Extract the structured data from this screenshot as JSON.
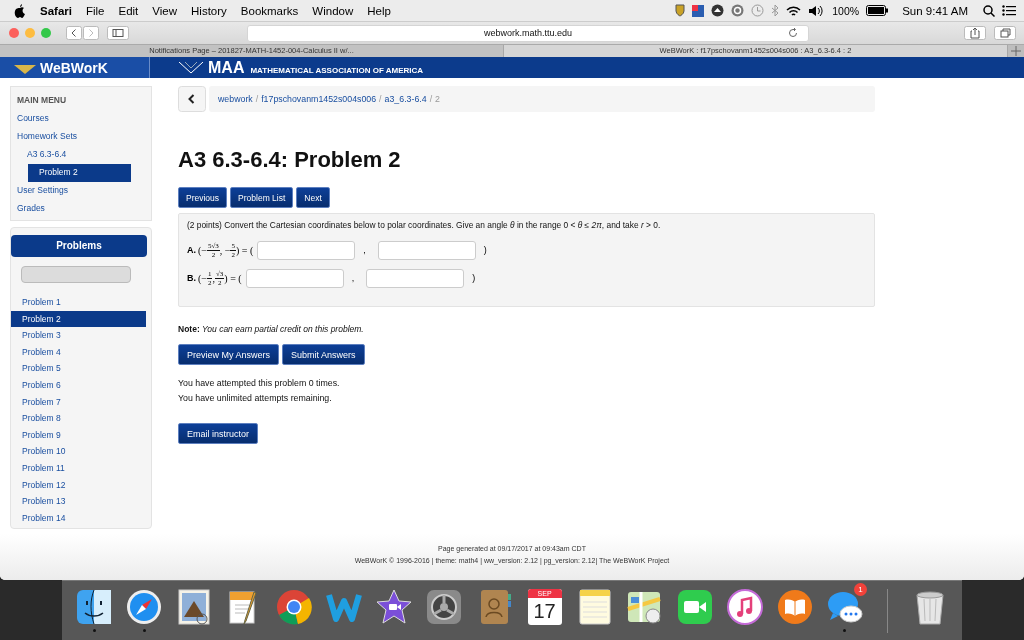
{
  "menu_bar": {
    "app": "Safari",
    "items": [
      "File",
      "Edit",
      "View",
      "History",
      "Bookmarks",
      "Window",
      "Help"
    ],
    "battery": "100%",
    "clock": "Sun 9:41 AM"
  },
  "browser": {
    "url": "webwork.math.ttu.edu",
    "tabs": [
      {
        "title": "Notifications Page – 201827-MATH-1452-004-Calculus II w/...",
        "selected": false
      },
      {
        "title": "WeBWorK : f17pschovanm1452s004s006 : A3_6.3-6.4 : 2",
        "selected": true
      }
    ]
  },
  "header": {
    "logo": "WeBWorK",
    "maa": "MAA",
    "maa_name": "MATHEMATICAL ASSOCIATION OF AMERICA"
  },
  "main_menu": {
    "title": "MAIN MENU",
    "items": [
      {
        "label": "Courses",
        "selected": false
      },
      {
        "label": "Homework Sets",
        "selected": false,
        "children": [
          {
            "label": "A3 6.3-6.4",
            "selected": false,
            "children": [
              {
                "label": "Problem 2",
                "selected": true
              }
            ]
          }
        ]
      },
      {
        "label": "User Settings",
        "selected": false
      },
      {
        "label": "Grades",
        "selected": false
      }
    ]
  },
  "problems_panel": {
    "title": "Problems",
    "items": [
      {
        "label": "Problem 1",
        "selected": false
      },
      {
        "label": "Problem 2",
        "selected": true
      },
      {
        "label": "Problem 3",
        "selected": false
      },
      {
        "label": "Problem 4",
        "selected": false
      },
      {
        "label": "Problem 5",
        "selected": false
      },
      {
        "label": "Problem 6",
        "selected": false
      },
      {
        "label": "Problem 7",
        "selected": false
      },
      {
        "label": "Problem 8",
        "selected": false
      },
      {
        "label": "Problem 9",
        "selected": false
      },
      {
        "label": "Problem 10",
        "selected": false
      },
      {
        "label": "Problem 11",
        "selected": false
      },
      {
        "label": "Problem 12",
        "selected": false
      },
      {
        "label": "Problem 13",
        "selected": false
      },
      {
        "label": "Problem 14",
        "selected": false
      }
    ]
  },
  "breadcrumb": {
    "items": [
      {
        "label": "webwork",
        "current": false
      },
      {
        "label": "f17pschovanm1452s004s006",
        "current": false
      },
      {
        "label": "a3_6.3-6.4",
        "current": false
      },
      {
        "label": "2",
        "current": true
      }
    ],
    "separators": [
      "/",
      "/",
      "/"
    ]
  },
  "title": "A3 6.3-6.4: Problem 2",
  "nav_buttons": [
    "Previous",
    "Problem List",
    "Next"
  ],
  "problem": {
    "intro": "(2 points) Convert the Cartesian coordinates below to polar coordinates. Give an angle *θ* in the range 0 < *θ* ≤ *2π*, and take *r* > 0.",
    "parts": [
      {
        "label": "A.",
        "terms": [
          {
            "prefix": "(−",
            "num": "5√3",
            "den": "2"
          },
          {
            "prefix": ", −",
            "num": "5",
            "den": "2"
          }
        ],
        "equals": ") = (",
        "comma": ",",
        "close": ")"
      },
      {
        "label": "B.",
        "terms": [
          {
            "prefix": "(−",
            "num": "1",
            "den": "2"
          },
          {
            "prefix": ",",
            "num": "√3",
            "den": "2"
          }
        ],
        "equals": ") = (",
        "comma": ",",
        "close": ")"
      }
    ]
  },
  "note": "**Note:** *You can earn partial credit on this problem.*",
  "answer_buttons": [
    "Preview My Answers",
    "Submit Answers"
  ],
  "attempts": [
    "You have attempted this problem 0 times.",
    "You have unlimited attempts remaining."
  ],
  "email_button": "Email instructor",
  "footer": [
    "Page generated at 09/17/2017 at 09:43am CDT",
    "WeBWorK © 1996-2016 | theme: math4 | ww_version: 2.12 | pg_version: 2.12| The WeBWorK Project"
  ],
  "dock": [
    {
      "kind": "finder",
      "running": true
    },
    {
      "kind": "safari",
      "running": true
    },
    {
      "kind": "mail",
      "running": false
    },
    {
      "kind": "pages",
      "running": false
    },
    {
      "kind": "chrome",
      "running": false
    },
    {
      "kind": "webstorm",
      "running": false
    },
    {
      "kind": "imovie",
      "running": false
    },
    {
      "kind": "prefs",
      "running": false
    },
    {
      "kind": "contacts",
      "running": false
    },
    {
      "kind": "calendar",
      "running": false,
      "month": "SEP",
      "day": "17"
    },
    {
      "kind": "notes",
      "running": false
    },
    {
      "kind": "maps",
      "running": false
    },
    {
      "kind": "facetime",
      "running": false
    },
    {
      "kind": "itunes",
      "running": false
    },
    {
      "kind": "ibooks",
      "running": false
    },
    {
      "kind": "messages",
      "running": true,
      "badge": "1"
    },
    {
      "kind": "trash",
      "running": false
    }
  ]
}
